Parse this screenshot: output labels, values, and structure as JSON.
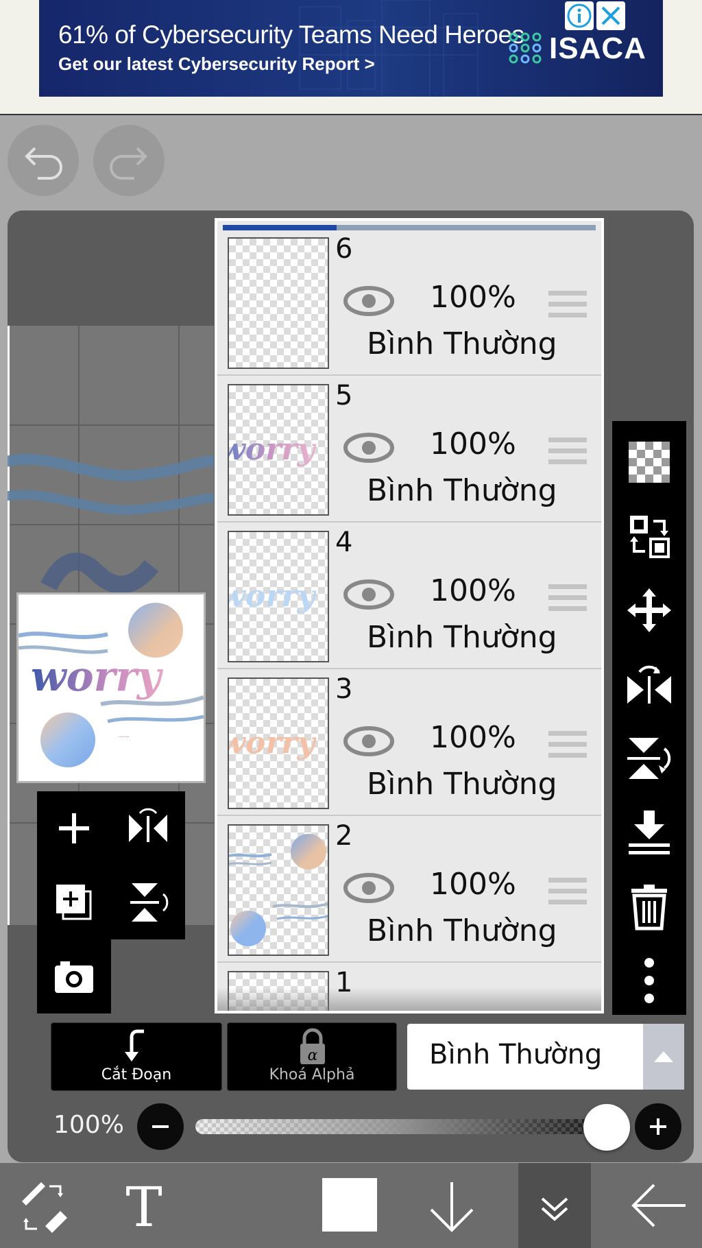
{
  "ad": {
    "headline": "61% of Cybersecurity Teams Need Heroes",
    "subline": "Get our latest Cybersecurity Report >",
    "brand": "ISACA",
    "info_icon": "info-icon",
    "close_icon": "close-icon"
  },
  "history": {
    "undo_icon": "undo-icon",
    "redo_icon": "redo-icon"
  },
  "preview": {
    "text": "worry"
  },
  "layers": [
    {
      "number": "6",
      "opacity": "100%",
      "blend": "Bình Thường"
    },
    {
      "number": "5",
      "opacity": "100%",
      "blend": "Bình Thường"
    },
    {
      "number": "4",
      "opacity": "100%",
      "blend": "Bình Thường"
    },
    {
      "number": "3",
      "opacity": "100%",
      "blend": "Bình Thường"
    },
    {
      "number": "2",
      "opacity": "100%",
      "blend": "Bình Thường"
    },
    {
      "number": "1"
    }
  ],
  "layer_thumbs": {
    "worry": "worry"
  },
  "layer_tools": [
    "add-layer-icon",
    "flip-horizontal-icon",
    "duplicate-layer-icon",
    "flip-vertical-icon",
    "camera-icon"
  ],
  "right_tools": [
    "transparency-icon",
    "layer-swap-icon",
    "move-icon",
    "flip-horizontal-icon",
    "flip-vertical-icon",
    "merge-down-icon",
    "trash-icon",
    "more-icon"
  ],
  "controls": {
    "clip_label": "Cắt Đoạn",
    "alpha_lock_label": "Khoá Alphả",
    "blend_mode": "Bình Thường",
    "opacity_label": "100%",
    "opacity_value": 1.0
  },
  "bottom_bar": [
    "brush-eraser-swap-icon",
    "text-tool-icon",
    "color-swatch-icon",
    "move-down-icon",
    "layer-menu-icon",
    "back-arrow-icon"
  ],
  "colors": {
    "ad_background": "#1a2f75",
    "selection_blue": "#1e4aa6",
    "panel_bg": "#5b5b5b",
    "layer_panel_bg": "#e9e9e9",
    "toolbar_black": "#000000",
    "bottom_bar": "#6c6c6c"
  }
}
